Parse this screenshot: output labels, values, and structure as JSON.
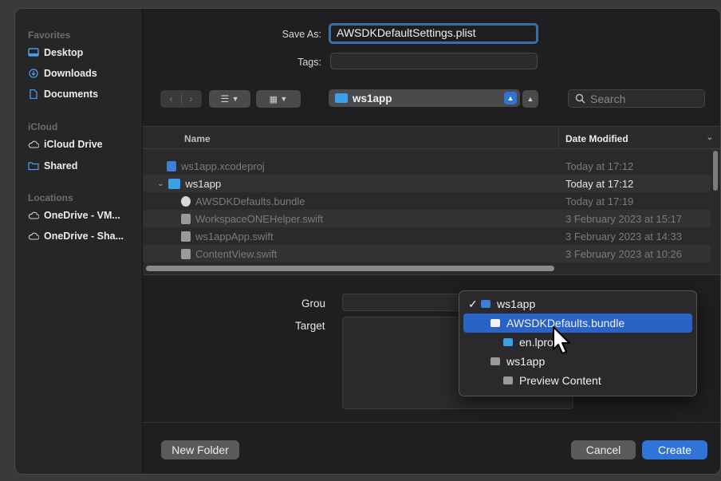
{
  "sidebar": {
    "favorites_label": "Favorites",
    "icloud_label": "iCloud",
    "locations_label": "Locations",
    "favorites": [
      {
        "label": "Desktop",
        "icon": "desktop-icon"
      },
      {
        "label": "Downloads",
        "icon": "downloads-icon"
      },
      {
        "label": "Documents",
        "icon": "documents-icon"
      }
    ],
    "icloud": [
      {
        "label": "iCloud Drive",
        "icon": "cloud-icon"
      },
      {
        "label": "Shared",
        "icon": "shared-folder-icon"
      }
    ],
    "locations": [
      {
        "label": "OneDrive - VM...",
        "icon": "cloud-icon"
      },
      {
        "label": "OneDrive - Sha...",
        "icon": "cloud-icon"
      }
    ]
  },
  "save_as": {
    "label": "Save As:",
    "value": "AWSDKDefaultSettings.plist"
  },
  "tags": {
    "label": "Tags:",
    "value": ""
  },
  "toolbar": {
    "location": "ws1app",
    "search_placeholder": "Search"
  },
  "browser": {
    "col_name": "Name",
    "col_date": "Date Modified",
    "rows": [
      {
        "name": "ws1app.xcodeproj",
        "date": "Today at 17:12",
        "dim": true
      },
      {
        "name": "ws1app",
        "date": "Today at 17:12",
        "dim": false
      },
      {
        "name": "AWSDKDefaults.bundle",
        "date": "Today at 17:19",
        "dim": true
      },
      {
        "name": "WorkspaceONEHelper.swift",
        "date": "3 February 2023 at 15:17",
        "dim": true
      },
      {
        "name": "ws1appApp.swift",
        "date": "3 February 2023 at 14:33",
        "dim": true
      },
      {
        "name": "ContentView.swift",
        "date": "3 February 2023 at 10:26",
        "dim": true
      }
    ]
  },
  "options": {
    "group_label": "Grou",
    "targets_label": "Target"
  },
  "group_menu": {
    "items": [
      {
        "label": "ws1app",
        "checked": true,
        "selected": false,
        "indent": 0
      },
      {
        "label": "AWSDKDefaults.bundle",
        "checked": false,
        "selected": true,
        "indent": 1
      },
      {
        "label": "en.lproj",
        "checked": false,
        "selected": false,
        "indent": 2
      },
      {
        "label": "ws1app",
        "checked": false,
        "selected": false,
        "indent": 1
      },
      {
        "label": "Preview Content",
        "checked": false,
        "selected": false,
        "indent": 2
      }
    ],
    "check_mark": "✓"
  },
  "buttons": {
    "new_folder": "New Folder",
    "cancel": "Cancel",
    "create": "Create"
  },
  "colors": {
    "accent": "#2f74d6",
    "selection": "#2a63c6",
    "folder": "#3aa0e8"
  }
}
